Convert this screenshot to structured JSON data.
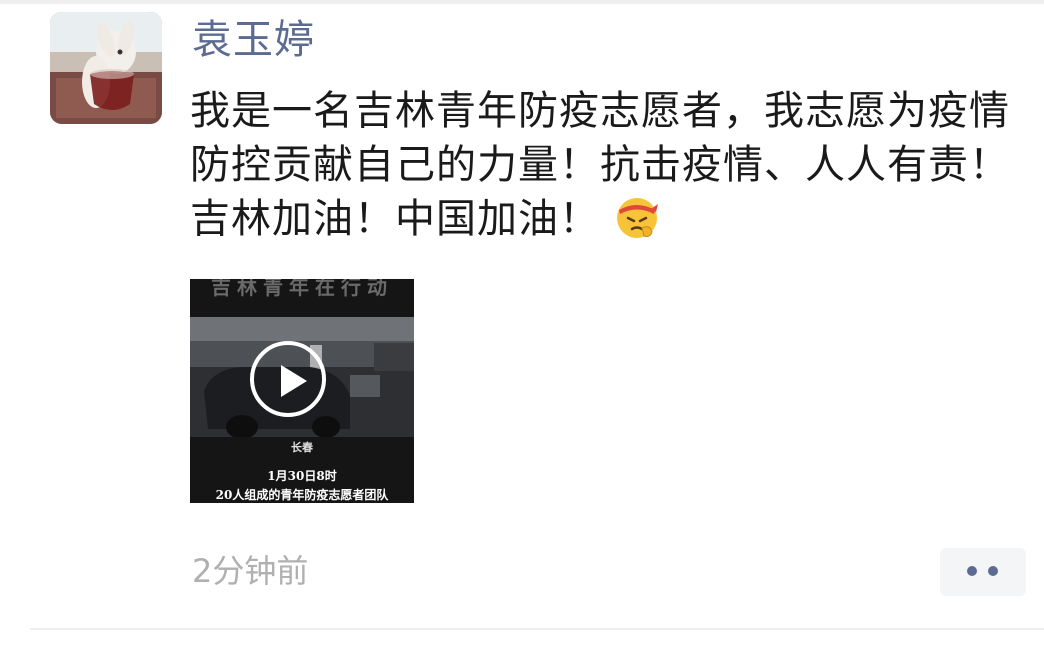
{
  "post": {
    "author": "袁玉婷",
    "text": "我是一名吉林青年防疫志愿者，我志愿为疫情防控贡献自己的力量！抗击疫情、人人有责！吉林加油！中国加油！",
    "emoji": "determined-face-headband-emoji",
    "timestamp": "2分钟前"
  },
  "video": {
    "top_text": "吉林青年在行动",
    "city": "长春",
    "date": "1月30日8时",
    "subtitle": "20人组成的青年防疫志愿者团队",
    "play_icon": "play-icon"
  },
  "actions": {
    "more_icon": "more-dots-icon"
  },
  "colors": {
    "author_name": "#5b6b92",
    "body_text": "#1a1a1a",
    "timestamp": "#b0b0b0",
    "more_button_bg": "#f4f5f7"
  }
}
